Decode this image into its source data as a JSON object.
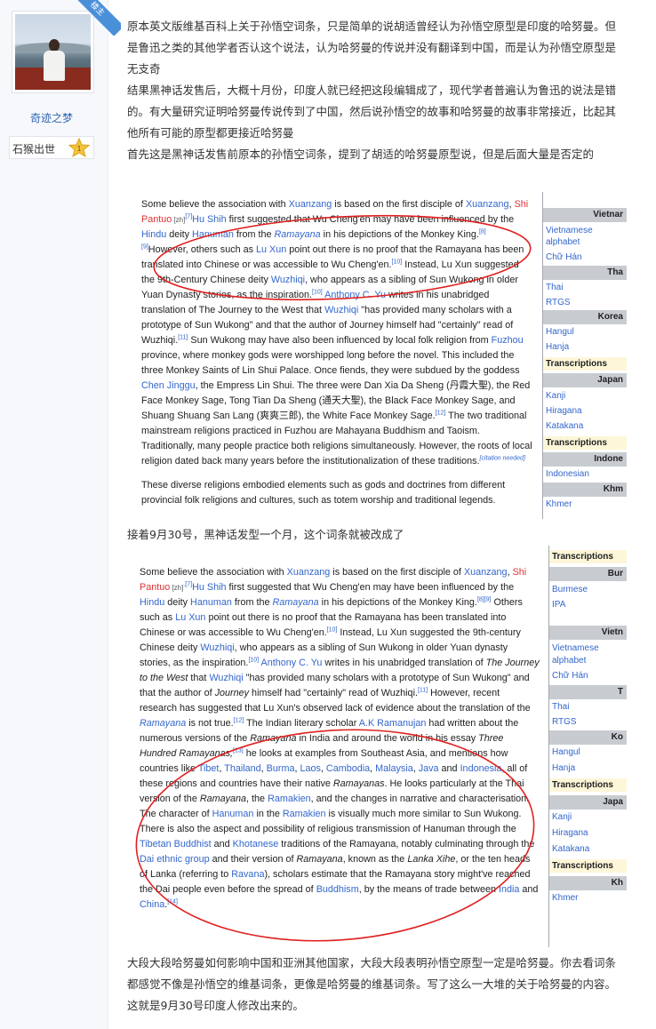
{
  "user": {
    "name": "奇迹之梦",
    "level_name": "石猴出世",
    "level_number": "1",
    "corner_badge": "楼主"
  },
  "post": {
    "paragraph_1": "原本英文版维基百科上关于孙悟空词条，只是简单的说胡适曾经认为孙悟空原型是印度的哈努曼。但是鲁迅之类的其他学者否认这个说法，认为哈努曼的传说并没有翻译到中国，而是认为孙悟空原型是无支奇",
    "paragraph_2": "结果黑神话发售后，大概十月份，印度人就已经把这段编辑成了，现代学者普遍认为鲁迅的说法是错的。有大量研究证明哈努曼传说传到了中国，然后说孙悟空的故事和哈努曼的故事非常接近，比起其他所有可能的原型都更接近哈努曼",
    "paragraph_3": "首先这是黑神话发售前原本的孙悟空词条，提到了胡适的哈努曼原型说，但是后面大量是否定的",
    "caption_2": "接着9月30号，黑神话发型一个月，这个词条就被改成了",
    "paragraph_final": "大段大段哈努曼如何影响中国和亚洲其他国家，大段大段表明孙悟空原型一定是哈努曼。你去看词条都感觉不像是孙悟空的维基词条，更像是哈努曼的维基词条。写了这么一大堆的关于哈努曼的内容。这就是9月30号印度人修改出来的。"
  },
  "screenshot_1": {
    "text": {
      "s1": "Some believe the association with ",
      "l_xuanzang": "Xuanzang",
      "s2": " is based on the first disciple of ",
      "l_xuanzang2": "Xuanzang",
      "s3": ", ",
      "l_shipantuo": "Shi Pantuo",
      "zh": " [zh]",
      "r7": "[7]",
      "l_hushih": "Hu Shih",
      "s4": " first suggested that Wu Cheng'en may have been influenced by the ",
      "l_hindu": "Hindu",
      "s5": " deity ",
      "l_hanuman": "Hanuman",
      "s6": " from the ",
      "l_ramayana": "Ramayana",
      "s7": " in his depictions of the Monkey King.",
      "r8": "[8]",
      "r9": "[9]",
      "s8": "However, others such as ",
      "l_luxun": "Lu Xun",
      "s9": " point out there is no proof that the Ramayana has been translated into Chinese or was accessible to Wu Cheng'en.",
      "r10": "[10]",
      "s10": " Instead, Lu Xun suggested the 9th-Century Chinese deity ",
      "l_wuzhiqi": "Wuzhiqi",
      "s11": ", who appears as a sibling of Sun Wukong in older Yuan Dynasty stories, as the inspiration.",
      "r10b": "[10]",
      "l_anthony": " Anthony C. Yu",
      "s12": " writes in his unabridged translation of The Journey to the West that ",
      "l_wuzhiqi2": "Wuzhiqi",
      "s13": " \"has provided many scholars with a prototype of Sun Wukong\" and that the author of Journey himself had \"certainly\" read of Wuzhiqi.",
      "r11": "[11]",
      "s14": " Sun Wukong may have also been influenced by local folk religion from ",
      "l_fuzhou": "Fuzhou",
      "s15": " province, where monkey gods were worshipped long before the novel. This included the three Monkey Saints of Lin Shui Palace. Once fiends, they were subdued by the goddess ",
      "l_chenjinggu": "Chen Jinggu",
      "s16": ", the Empress Lin Shui. The three were Dan Xia Da Sheng (丹霞大聖), the Red Face Monkey Sage, Tong Tian Da Sheng (通天大聖), the Black Face Monkey Sage, and Shuang Shuang San Lang (爽爽三郎), the White Face Monkey Sage.",
      "r12": "[12]",
      "s17": " The two traditional mainstream religions practiced in Fuzhou are Mahayana Buddhism and Taoism. Traditionally, many people practice both religions simultaneously. However, the roots of local religion dated back many years before the institutionalization of these traditions.",
      "cn": "[citation needed]",
      "s18": "These diverse religions embodied elements such as gods and doctrines from different provincial folk religions and cultures, such as totem worship and traditional legends."
    },
    "sidebar": {
      "h_vietnam": "Vietnar",
      "i_vn1": "Vietnamese",
      "i_vn2": "alphabet",
      "i_chuhan": "Chữ Hán",
      "h_thai": "Tha",
      "i_thai": "Thai",
      "i_rtgs": "RTGS",
      "h_korean": "Korea",
      "i_hangul": "Hangul",
      "i_hanja": "Hanja",
      "t1": "Transcriptions",
      "h_japanese": "Japan",
      "i_kanji": "Kanji",
      "i_hiragana": "Hiragana",
      "i_katakana": "Katakana",
      "t2": "Transcriptions",
      "h_indonesian": "Indone",
      "i_indonesian": "Indonesian",
      "h_khmer": "Khm",
      "i_khmer": "Khmer"
    }
  },
  "screenshot_2": {
    "text": {
      "s1": "Some believe the association with ",
      "l_xuanzang": "Xuanzang",
      "s2": " is based on the first disciple of ",
      "l_xuanzang2": "Xuanzang",
      "s3": ", ",
      "l_shipantuo": "Shi Pantuo",
      "zh": " [zh]",
      "r7": ".[7]",
      "l_hushih": "Hu Shih",
      "s4": " first suggested that Wu Cheng'en may have been influenced by the ",
      "l_hindu": "Hindu",
      "s5": " deity ",
      "l_hanuman": "Hanuman",
      "s6": " from the ",
      "l_ramayana": "Ramayana",
      "s7": " in his depictions of the Monkey King.",
      "r89": "[8][9]",
      "s8": " Others such as ",
      "l_luxun": "Lu Xun",
      "s9": " point out there is no proof that the Ramayana has been translated into Chinese or was accessible to Wu Cheng'en.",
      "r10": "[10]",
      "s10": " Instead, Lu Xun suggested the 9th-century Chinese deity ",
      "l_wuzhiqi": "Wuzhiqi",
      "s11": ", who appears as a sibling of Sun Wukong in older Yuan dynasty stories, as the inspiration.",
      "r10b": "[10]",
      "l_anthony": " Anthony C. Yu",
      "s12": " writes in his unabridged translation of ",
      "i_journey": "The Journey to the West",
      "s12b": " that ",
      "l_wuzhiqi2": "Wuzhiqi",
      "s13": " \"has provided many scholars with a prototype of Sun Wukong\" and that the author of ",
      "i_journey2": "Journey",
      "s13b": " himself had \"certainly\" read of Wuzhiqi.",
      "r11": "[11]",
      "s14": " However, recent research has suggested that Lu Xun's observed lack of evidence about the translation of the ",
      "l_ramayana2": "Ramayana",
      "s15": " is not true.",
      "r12": "[12]",
      "s16": " The Indian literary scholar ",
      "l_ramanujan": "A.K Ramanujan",
      "s17": " had written about the numerous versions of the ",
      "i_ramayana": "Ramayana",
      "s18": " in India and around the world in his essay ",
      "i_essay": "Three Hundred Ramayanas,",
      "r13": "[13]",
      "s19": " he looks at examples from Southeast Asia, and mentions how countries like ",
      "l_tibet": "Tibet",
      "c1": ", ",
      "l_thailand": "Thailand",
      "c2": ", ",
      "l_burma": "Burma",
      "c3": ", ",
      "l_laos": "Laos",
      "c4": ", ",
      "l_cambodia": "Cambodia",
      "c5": ", ",
      "l_malaysia": "Malaysia",
      "c6": ", ",
      "l_java": "Java",
      "s20": " and ",
      "l_indonesia": "Indonesia",
      "s21": ", all of these regions and countries have their native ",
      "i_ramayanas": "Ramayanas",
      "s22": ". He looks particularly at the Thai version of the ",
      "i_ramayana2": "Ramayana",
      "s23": ", the ",
      "l_ramakien": "Ramakien",
      "s24": ", and the changes in narrative and characterisation. The character of ",
      "l_hanuman2": "Hanuman",
      "s25": " in the ",
      "l_ramakien2": "Ramakien",
      "s26": " is visually much more similar to Sun Wukong. There is also the aspect and possibility of religious transmission of Hanuman through the ",
      "l_tibetan": "Tibetan Buddhist",
      "s27": " and ",
      "l_khotanese": "Khotanese",
      "s28": " traditions of the Ramayana, notably culminating through the ",
      "l_dai": "Dai ethnic group",
      "s29": " and their version of ",
      "i_ramayana3": "Ramayana",
      "s30": ", known as the ",
      "i_lanka": "Lanka Xihe",
      "s31": ", or the ten heads of Lanka (referring to ",
      "l_ravana": "Ravana",
      "s32": "), scholars estimate that the Ramayana story might've reached the Dai people even before the spread of ",
      "l_buddhism": "Buddhism",
      "s33": ", by the means of trade between ",
      "l_india": "India",
      "s34": " and ",
      "l_china": "China",
      "s35": ".",
      "r14": "[14]"
    },
    "sidebar": {
      "t0": "Transcriptions",
      "h_burmese": "Bur",
      "i_burmese": "Burmese",
      "i_ipa": "IPA",
      "h_vietnam": "Vietn",
      "i_vn1": "Vietnamese",
      "i_vn2": "alphabet",
      "i_chuhan": "Chữ Hán",
      "h_thai": "T",
      "i_thai": "Thai",
      "i_rtgs": "RTGS",
      "h_korean": "Ko",
      "i_hangul": "Hangul",
      "i_hanja": "Hanja",
      "t1": "Transcriptions",
      "h_japanese": "Japa",
      "i_kanji": "Kanji",
      "i_hiragana": "Hiragana",
      "i_katakana": "Katakana",
      "t2": "Transcriptions",
      "h_khmer": "Kh",
      "i_khmer": "Khmer"
    }
  },
  "colors": {
    "link": "#3366cc",
    "red_link": "#dd3333",
    "annotation_red": "#e02020",
    "username": "#2d64b3"
  }
}
